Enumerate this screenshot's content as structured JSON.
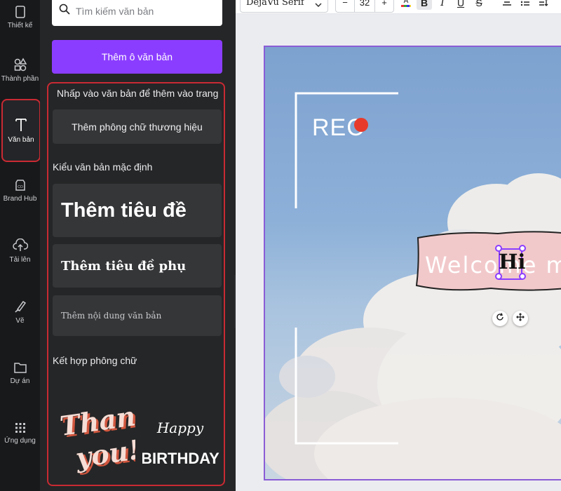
{
  "rail": {
    "items": [
      {
        "label": "Thiết kế",
        "icon": "template-icon"
      },
      {
        "label": "Thành phần",
        "icon": "shapes-icon"
      },
      {
        "label": "Văn bản",
        "icon": "text-icon",
        "active": true
      },
      {
        "label": "Brand Hub",
        "icon": "brand-icon"
      },
      {
        "label": "Tải lên",
        "icon": "upload-icon"
      },
      {
        "label": "Vẽ",
        "icon": "draw-icon"
      },
      {
        "label": "Dự án",
        "icon": "folder-icon"
      },
      {
        "label": "Ứng dụng",
        "icon": "apps-icon"
      }
    ]
  },
  "panel": {
    "search_placeholder": "Tìm kiếm văn bản",
    "add_textbox": "Thêm ô văn bản",
    "hint": "Nhấp vào văn bản để thêm vào trang",
    "brand_fonts": "Thêm phông chữ thương hiệu",
    "default_styles_header": "Kiểu văn bản mặc định",
    "heading": "Thêm tiêu đề",
    "subheading": "Thêm tiêu đề phụ",
    "body": "Thêm nội dung văn bản",
    "combos_header": "Kết hợp phông chữ",
    "combo1": {
      "line1": "Thank",
      "line2": "you!"
    },
    "combo2": {
      "line1": "Happy",
      "line2": "BIRTHDAY"
    }
  },
  "toolbar": {
    "font": "DejaVu Serif",
    "size": "32",
    "minus": "−",
    "plus": "+",
    "bold": "B",
    "italic": "I",
    "underline": "U",
    "strike": "S"
  },
  "canvas": {
    "rec": "REC",
    "welcome": "Welcome   my",
    "selected_text": "Hi"
  },
  "colors": {
    "accent": "#8b3dff",
    "highlight": "#c92a33",
    "rec_dot": "#e83a2a",
    "banner": "#f2c9cb"
  }
}
